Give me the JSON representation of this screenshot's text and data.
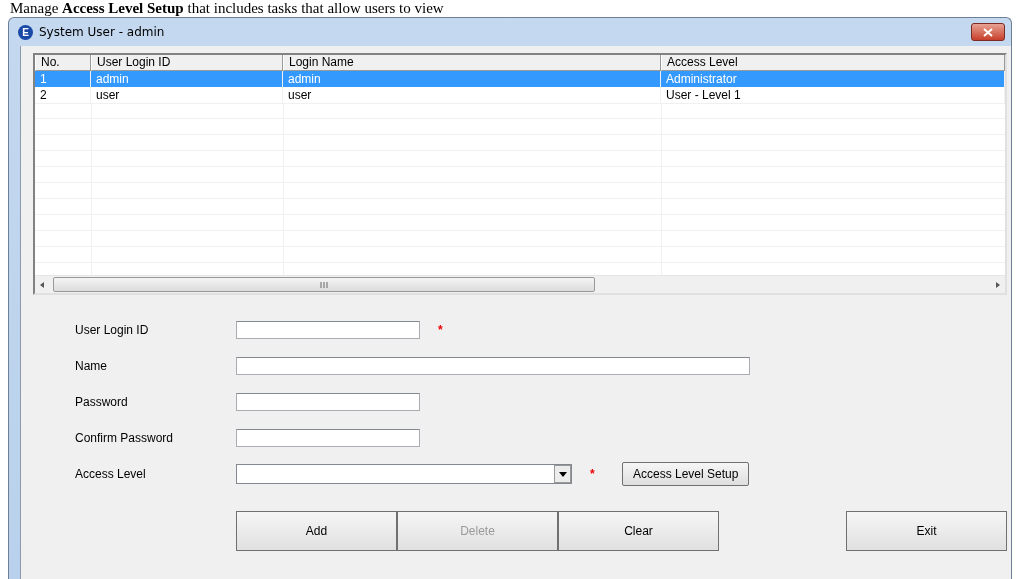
{
  "document_text": "Manage **Access Level Setup** that includes tasks that allow users to view",
  "window": {
    "title": "System User - admin",
    "icon": "E"
  },
  "table": {
    "columns": [
      "No.",
      "User Login ID",
      "Login Name",
      "Access Level"
    ],
    "rows": [
      {
        "cells": [
          "1",
          "admin",
          "admin",
          "Administrator"
        ],
        "selected": true
      },
      {
        "cells": [
          "2",
          "user",
          "user",
          "User - Level 1"
        ],
        "selected": false
      }
    ]
  },
  "form": {
    "fields": [
      {
        "label": "User Login ID",
        "kind": "short",
        "marker": "*"
      },
      {
        "label": "Name",
        "kind": "long"
      },
      {
        "label": "Password",
        "kind": "short"
      },
      {
        "label": "Confirm Password",
        "kind": "short"
      },
      {
        "label": "Access Level",
        "kind": "dropdown",
        "marker": "*",
        "button": "Access Level Setup"
      }
    ]
  },
  "buttons": [
    {
      "label": "Add",
      "disabled": false
    },
    {
      "label": "Delete",
      "disabled": true
    },
    {
      "label": "Clear",
      "disabled": false
    },
    {
      "label": "Exit",
      "disabled": false
    }
  ]
}
